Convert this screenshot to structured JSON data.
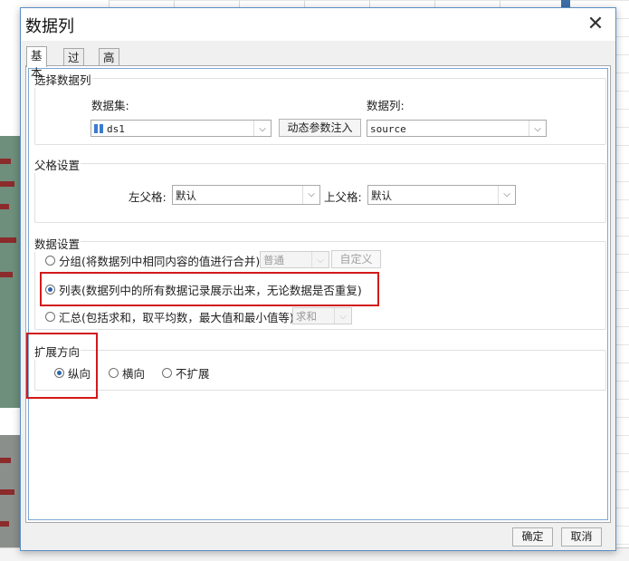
{
  "dialog": {
    "title": "数据列",
    "tabs": [
      {
        "label": "基本",
        "active": true
      },
      {
        "label": "过滤",
        "active": false
      },
      {
        "label": "高级",
        "active": false
      }
    ],
    "select_data_column": {
      "title": "选择数据列",
      "dataset_label": "数据集:",
      "dataset_value": "ds1",
      "dynamic_param_button": "动态参数注入",
      "column_label": "数据列:",
      "column_value": "source"
    },
    "parent_settings": {
      "title": "父格设置",
      "left_parent_label": "左父格:",
      "left_parent_value": "默认",
      "top_parent_label": "上父格:",
      "top_parent_value": "默认"
    },
    "data_settings": {
      "title": "数据设置",
      "options": [
        {
          "label": "分组(将数据列中相同内容的值进行合并)",
          "checked": false
        },
        {
          "label": "列表(数据列中的所有数据记录展示出来，无论数据是否重复)",
          "checked": true
        },
        {
          "label": "汇总(包括求和，取平均数，最大值和最小值等)",
          "checked": false
        }
      ],
      "group_mode_value": "普通",
      "custom_button": "自定义",
      "summary_mode_value": "求和"
    },
    "expand_direction": {
      "title": "扩展方向",
      "options": [
        {
          "label": "纵向",
          "checked": true
        },
        {
          "label": "横向",
          "checked": false
        },
        {
          "label": "不扩展",
          "checked": false
        }
      ]
    },
    "footer": {
      "ok_label": "确定",
      "cancel_label": "取消"
    }
  },
  "colors": {
    "highlight": "#d11a1a",
    "accent": "#2a64b0"
  }
}
